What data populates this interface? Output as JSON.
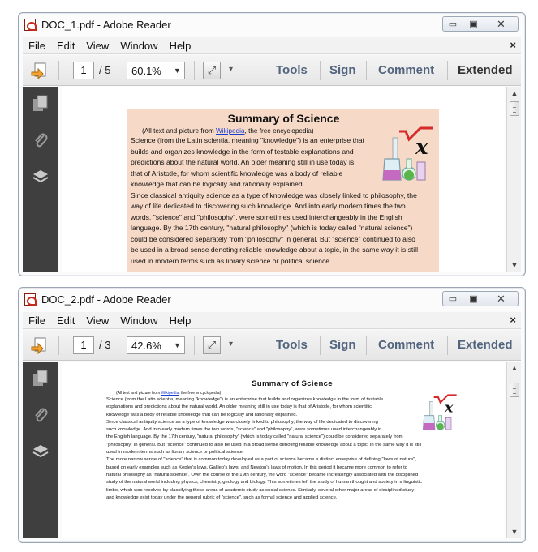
{
  "windows": [
    {
      "title": "DOC_1.pdf - Adobe Reader",
      "menu": [
        "File",
        "Edit",
        "View",
        "Window",
        "Help"
      ],
      "menu_close": "×",
      "toolbar": {
        "page_current": "1",
        "page_total": "/ 5",
        "zoom": "60.1%",
        "tools": "Tools",
        "sign": "Sign",
        "comment": "Comment",
        "extended": "Extended"
      },
      "document": {
        "title": "Summary of Science",
        "credit_prefix": "(All text and picture from ",
        "credit_link": "Wikipedia",
        "credit_suffix": ", the free encyclopedia)",
        "lines_wrapped": [
          "Science (from the Latin scientia, meaning \"knowledge\") is an enterprise that",
          "builds and organizes knowledge in the form of testable explanations and",
          "predictions about the natural world. An older meaning still in use today is",
          "that of Aristotle, for whom scientific knowledge was a body of reliable",
          "knowledge that can be logically and rationally explained."
        ],
        "lines_full": [
          "Since classical antiquity science as a type of knowledge was closely linked to philosophy, the",
          "way of life dedicated to discovering such knowledge. And into early modern times the two",
          "words, \"science\" and \"philosophy\", were sometimes used interchangeably in the English",
          "language. By the 17th century, \"natural philosophy\" (which is today called \"natural science\")",
          "could be considered separately from \"philosophy\" in general. But \"science\" continued to also",
          "be used in a broad sense denoting reliable knowledge about a topic, in the same way it is still",
          "used in modern terms such as library science or political science."
        ]
      }
    },
    {
      "title": "DOC_2.pdf - Adobe Reader",
      "menu": [
        "File",
        "Edit",
        "View",
        "Window",
        "Help"
      ],
      "menu_close": "×",
      "toolbar": {
        "page_current": "1",
        "page_total": "/ 3",
        "zoom": "42.6%",
        "tools": "Tools",
        "sign": "Sign",
        "comment": "Comment",
        "extended": "Extended"
      },
      "document": {
        "title": "Summary of Science",
        "credit_prefix": "(All text and picture from ",
        "credit_link": "Wikipedia",
        "credit_suffix": ", the free encyclopedia)",
        "lines_wrapped": [
          "Science (from the Latin scientia, meaning \"knowledge\") is an enterprise that builds and organizes knowledge in the form of testable",
          "explanations and predictions about the natural world. An older meaning still in use today is that of Aristotle, for whom scientific",
          "knowledge was a body of reliable knowledge that can be logically and rationally explained.",
          "Since classical antiquity science as a type of knowledge was closely linked to philosophy, the way of life dedicated to discovering",
          "such knowledge. And into early modern times the two words, \"science\" and \"philosophy\", were sometimes used interchangeably in",
          "the English language. By the 17th century, \"natural philosophy\" (which is today called \"natural science\") could be considered separately from"
        ],
        "lines_full": [
          "\"philosophy\" in general. But \"science\" continued to also be used in a broad sense denoting reliable knowledge about a topic, in the same way it is still",
          "used in modern terms such as library science or political science.",
          "The more narrow sense of \"science\" that is common today developed as a part of science became a distinct enterprise of defining \"laws of nature\",",
          "based on early examples such as Kepler's laws, Galileo's laws, and Newton's laws of motion. In this period it became more common to refer to",
          "natural philosophy as \"natural science\". Over the course of the 19th century, the word \"science\" became increasingly associated with the disciplined",
          "study of the natural world including physics, chemistry, geology and biology. This sometimes left the study of human thought and society in a linguistic",
          "limbo, which was resolved by classifying these areas of academic study as social science. Similarly, several other major areas of disciplined study",
          "and knowledge exist today under the general rubric of \"science\", such as formal science and applied science."
        ]
      }
    }
  ]
}
